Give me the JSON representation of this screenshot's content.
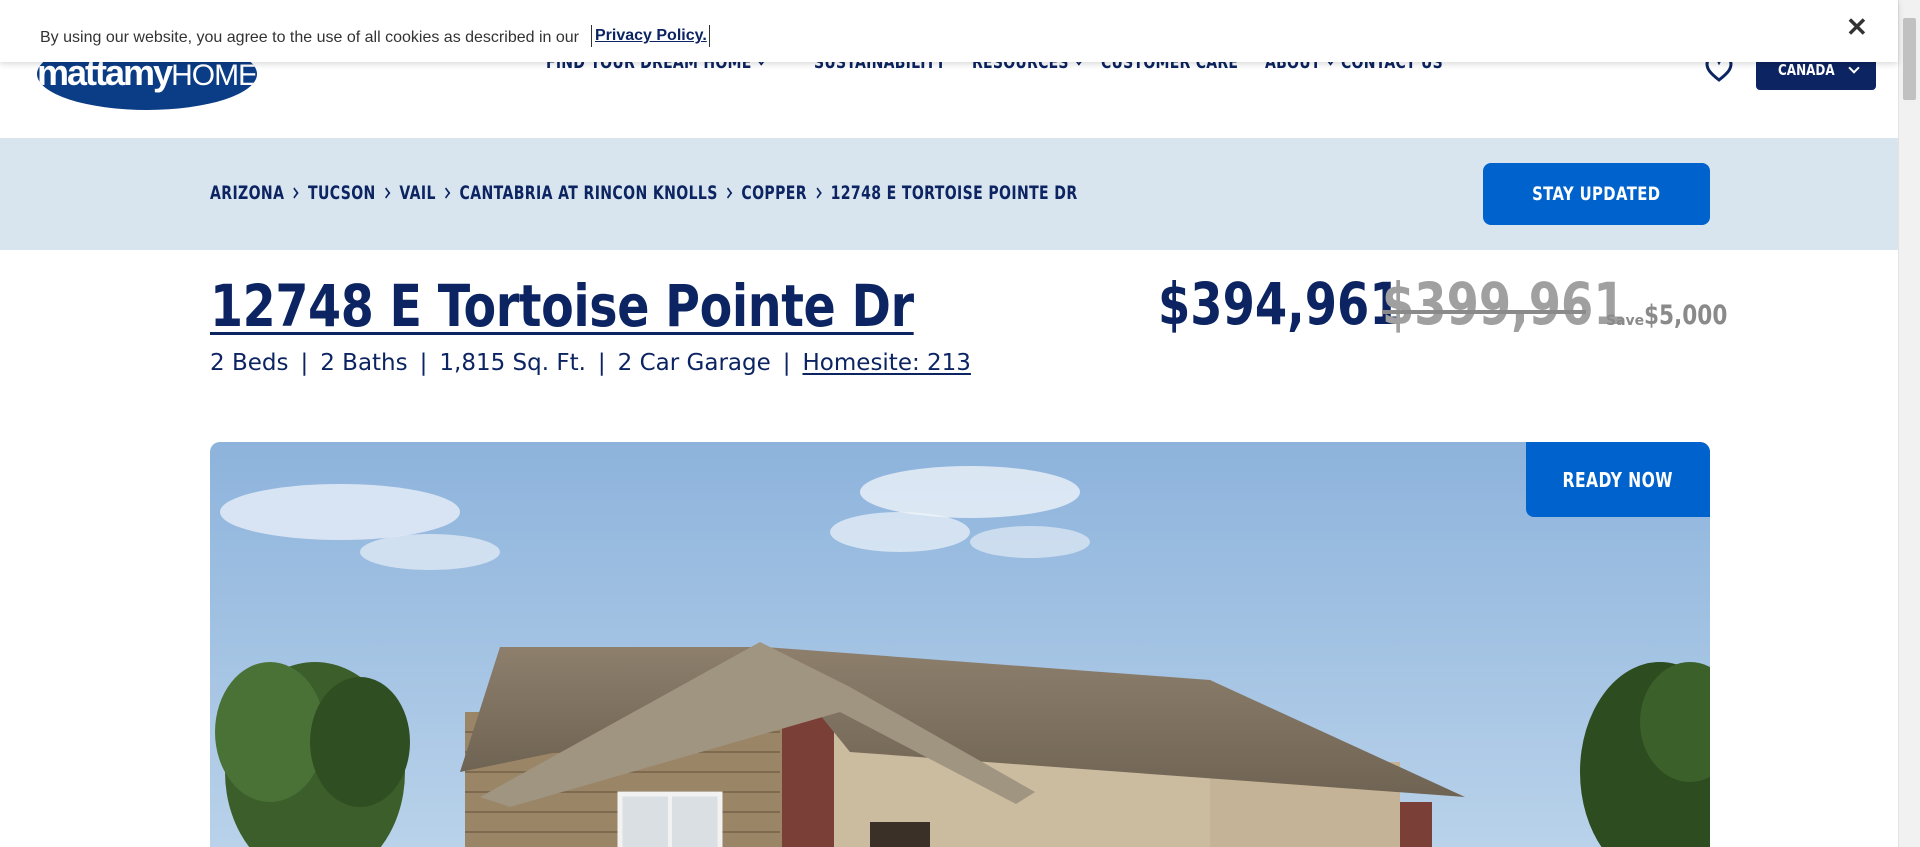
{
  "cookie_banner": {
    "text": "By using our website, you agree to the use of all cookies as described in our",
    "link": "Privacy Policy.",
    "close": "✕"
  },
  "header": {
    "logo_bold": "mattamy",
    "logo_light": "HOMES",
    "nav": [
      {
        "label": "FIND YOUR DREAM HOME",
        "has_dropdown": true
      },
      {
        "label": "SUSTAINABILITY",
        "has_dropdown": false
      },
      {
        "label": "RESOURCES",
        "has_dropdown": true
      },
      {
        "label": "CUSTOMER CARE",
        "has_dropdown": false
      },
      {
        "label": "ABOUT",
        "has_dropdown": true
      },
      {
        "label": "CONTACT US",
        "has_dropdown": false
      }
    ],
    "favorites_icon": "heart-icon",
    "country": "CANADA"
  },
  "breadcrumb": [
    "ARIZONA",
    "TUCSON",
    "VAIL",
    "CANTABRIA AT RINCON KNOLLS",
    "COPPER",
    "12748 E TORTOISE POINTE DR"
  ],
  "stay_updated": "STAY UPDATED",
  "listing": {
    "title": "12748 E Tortoise Pointe Dr",
    "specs": [
      "2 Beds",
      "2 Baths",
      "1,815 Sq. Ft.",
      "2 Car Garage"
    ],
    "homesite": "Homesite: 213",
    "separator": "|",
    "price": "$394,961",
    "old_price": "$399,961",
    "save_label": "Save",
    "save_amount": "$5,000",
    "badge": "READY NOW"
  },
  "colors": {
    "navy": "#0c2461",
    "brand_blue": "#0062cc",
    "band": "#d9e5ee",
    "muted": "#8a8a8a"
  }
}
